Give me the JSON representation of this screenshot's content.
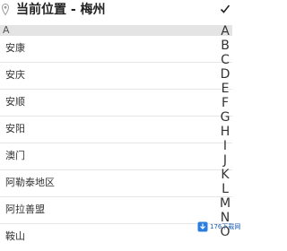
{
  "header": {
    "title": "当前位置 -   梅州",
    "location_icon": "map-pin-icon",
    "confirm_icon": "checkmark-icon"
  },
  "section": {
    "letter": "A"
  },
  "cities": [
    "安康",
    "安庆",
    "安顺",
    "安阳",
    "澳门",
    "阿勒泰地区",
    "阿拉善盟",
    "鞍山"
  ],
  "index_letters": [
    "A",
    "B",
    "C",
    "D",
    "E",
    "F",
    "G",
    "H",
    "I",
    "J",
    "K",
    "L",
    "M",
    "N",
    "O"
  ],
  "watermark": {
    "text": "176下载网"
  }
}
